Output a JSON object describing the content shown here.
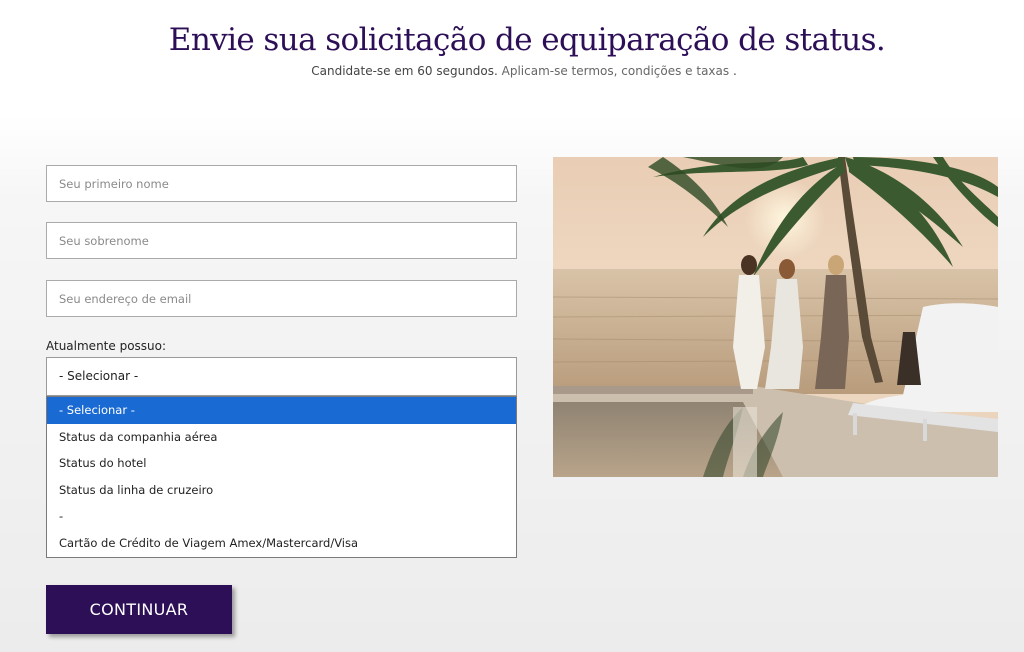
{
  "header": {
    "title": "Envie sua solicitação de equiparação de status.",
    "subtitle_text": "Candidate-se em 60 segundos. ",
    "terms_link": "Aplicam-se termos, condições e taxas",
    "subtitle_end": " ."
  },
  "form": {
    "first_name": {
      "placeholder": "Seu primeiro nome",
      "value": ""
    },
    "last_name": {
      "placeholder": "Seu sobrenome",
      "value": ""
    },
    "email": {
      "placeholder": "Seu endereço de email",
      "value": ""
    },
    "status_label": "Atualmente possuo:",
    "status_selected": "- Selecionar -",
    "status_options": [
      "- Selecionar -",
      "Status da companhia aérea",
      "Status do hotel",
      "Status da linha de cruzeiro",
      "-",
      "Cartão de Crédito de Viagem Amex/Mastercard/Visa"
    ],
    "highlighted_option_index": 0,
    "continue_label": "CONTINUAR"
  },
  "colors": {
    "brand_purple": "#2c0f57",
    "option_highlight": "#1a6ad4"
  },
  "image": {
    "description_icon": "resort-beach-photo"
  }
}
